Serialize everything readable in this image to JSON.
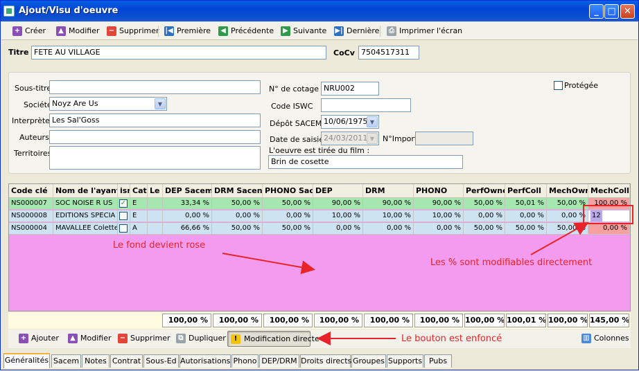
{
  "window": {
    "title": "Ajout/Visu d'oeuvre"
  },
  "toolbar": {
    "creer": "Créer",
    "modifier": "Modifier",
    "supprimer": "Supprimer",
    "premiere": "Première",
    "precedente": "Précédente",
    "suivante": "Suivante",
    "derniere": "Dernière",
    "imprimer": "Imprimer l'écran"
  },
  "header": {
    "titre_label": "Titre",
    "titre_value": "FETE AU VILLAGE",
    "cocv_label": "CoCv",
    "cocv_value": "7504517311"
  },
  "details": {
    "sous_titre_label": "Sous-titre",
    "sous_titre_value": "",
    "societe_label": "Société",
    "societe_value": "Noyz Are Us",
    "interprete_label": "Interprète",
    "interprete_value": "Les Sal'Goss",
    "auteurs_label": "Auteurs",
    "auteurs_value": "",
    "territoires_label": "Territoires",
    "territoires_value": "",
    "cotage_label": "N° de cotage",
    "cotage_value": "NRU002",
    "iswc_label": "Code ISWC",
    "iswc_value": "",
    "depot_label": "Dépôt SACEM",
    "depot_value": "10/06/1975",
    "saisie_label": "Date de saisie",
    "saisie_value": "24/03/2011 (",
    "import_label": "N°Import",
    "import_value": "",
    "film_label": "L'oeuvre est tirée du film :",
    "film_value": "Brin de cosette",
    "protegee_label": "Protégée"
  },
  "grid": {
    "columns": [
      "Code clé",
      "Nom de l'ayant",
      "ism",
      "Cat",
      "Le",
      "DEP Sacem",
      "DRM Sacen",
      "PHONO Sac",
      "DEP",
      "DRM",
      "PHONO",
      "PerfOwne",
      "PerfColl",
      "MechOwr",
      "MechColl"
    ],
    "rows": [
      {
        "code": "NS000007",
        "nom": "SOC NOISE R US",
        "ism": true,
        "cat": "E",
        "le": "",
        "dep_sacem": "33,34 %",
        "drm_sacem": "50,00 %",
        "phono_sacem": "50,00 %",
        "dep": "90,00 %",
        "drm": "90,00 %",
        "phono": "90,00 %",
        "perf_owner": "50,00 %",
        "perf_coll": "50,01 %",
        "mech_owner": "50,00 %",
        "mech_coll": "100,00 %"
      },
      {
        "code": "NS000008",
        "nom": "EDITIONS SPECIA",
        "ism": false,
        "cat": "E",
        "le": "",
        "dep_sacem": "0,00 %",
        "drm_sacem": "0,00 %",
        "phono_sacem": "0,00 %",
        "dep": "10,00 %",
        "drm": "10,00 %",
        "phono": "10,00 %",
        "perf_owner": "0,00 %",
        "perf_coll": "0,00 %",
        "mech_owner": "0,00 %",
        "mech_coll": "12"
      },
      {
        "code": "NS000004",
        "nom": "MAVALLEE Colette",
        "ism": false,
        "cat": "A",
        "le": "",
        "dep_sacem": "66,66 %",
        "drm_sacem": "50,00 %",
        "phono_sacem": "50,00 %",
        "dep": "0,00 %",
        "drm": "0,00 %",
        "phono": "0,00 %",
        "perf_owner": "50,00 %",
        "perf_coll": "50,00 %",
        "mech_owner": "50,00 %",
        "mech_coll": "0,00 %"
      }
    ],
    "totals": [
      "100,00 %",
      "100,00 %",
      "100,00 %",
      "100,00 %",
      "100,00 %",
      "100,00 %",
      "100,00 %",
      "100,01 %",
      "100,00 %",
      "145,00 %"
    ]
  },
  "bottom_toolbar": {
    "ajouter": "Ajouter",
    "modifier": "Modifier",
    "supprimer": "Supprimer",
    "dupliquer": "Dupliquer",
    "modification_directe": "Modification directe",
    "colonnes": "Colonnes"
  },
  "tabs": [
    "Généralités",
    "Sacem",
    "Notes",
    "Contrat",
    "Sous-Ed",
    "Autorisations",
    "Phono",
    "DEP/DRM",
    "Droits directs",
    "Groupes",
    "Supports",
    "Pubs"
  ],
  "annotations": {
    "fond_rose": "Le fond devient rose",
    "pct_modifiables": "Les % sont modifiables directement",
    "bouton_enfonce": "Le bouton est enfoncé"
  },
  "colors": {
    "row_green": "#a6e7b0",
    "row_blue": "#cde3f2",
    "row_red": "#f7a0a0",
    "grid_pink": "#f29bef",
    "annotation_red": "#e8242a"
  }
}
